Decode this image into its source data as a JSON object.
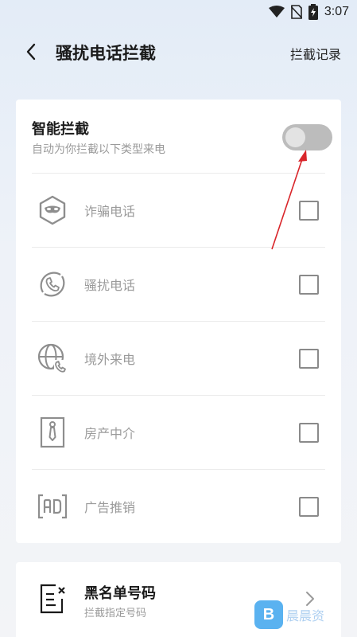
{
  "status_bar": {
    "time": "3:07",
    "icons": [
      "wifi-icon",
      "no-sim-icon",
      "battery-charging-icon"
    ]
  },
  "header": {
    "back_icon": "chevron-left-icon",
    "title": "骚扰电话拦截",
    "record_link": "拦截记录"
  },
  "smart_block": {
    "title": "智能拦截",
    "subtitle": "自动为你拦截以下类型来电",
    "toggle_on": false
  },
  "types": [
    {
      "label": "诈骗电话",
      "icon": "fraud-mask-icon",
      "checked": false
    },
    {
      "label": "骚扰电话",
      "icon": "phone-harass-icon",
      "checked": false
    },
    {
      "label": "境外来电",
      "icon": "globe-phone-icon",
      "checked": false
    },
    {
      "label": "房产中介",
      "icon": "real-estate-agent-icon",
      "checked": false
    },
    {
      "label": "广告推销",
      "icon": "advert-icon",
      "checked": false
    }
  ],
  "blacklist": {
    "title": "黑名单号码",
    "subtitle": "拦截指定号码",
    "icon": "blacklist-doc-icon",
    "chevron_icon": "chevron-right-icon"
  },
  "annotation": {
    "arrow_color": "#d9252a"
  },
  "watermark": {
    "logo": "B",
    "text": "晨晨资"
  }
}
